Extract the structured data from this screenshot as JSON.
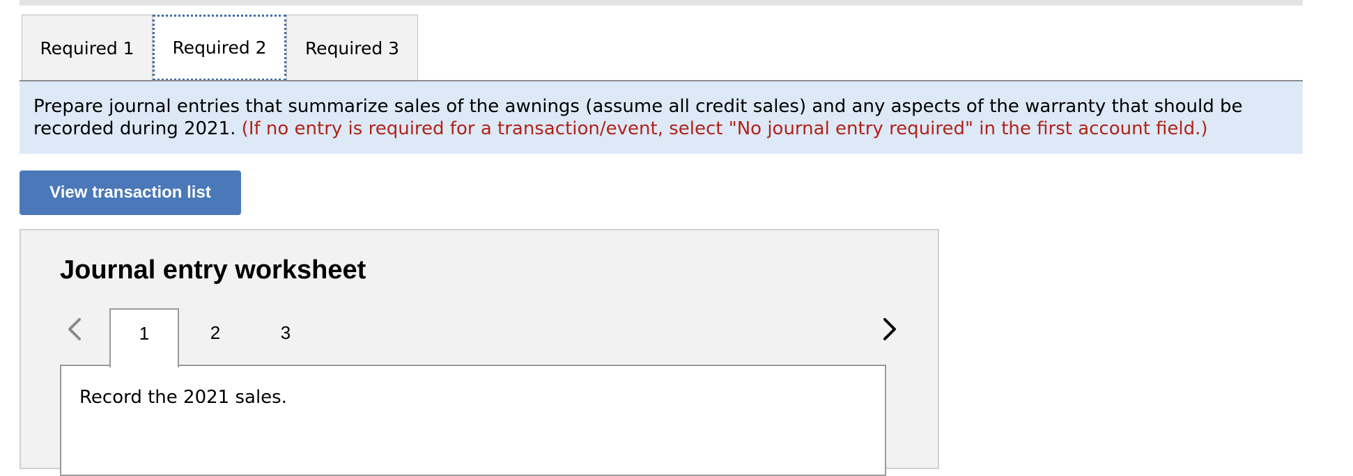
{
  "tabs": [
    {
      "label": "Required 1",
      "active": false
    },
    {
      "label": "Required 2",
      "active": true
    },
    {
      "label": "Required 3",
      "active": false
    }
  ],
  "instructions": {
    "text": "Prepare journal entries that summarize sales of the awnings (assume all credit sales) and any aspects of the warranty that should be recorded during 2021. ",
    "note": "(If no entry is required for a transaction/event, select \"No journal entry required\" in the first account field.)"
  },
  "view_transaction_button": "View transaction list",
  "worksheet": {
    "title": "Journal entry worksheet",
    "tabs": [
      "1",
      "2",
      "3"
    ],
    "active_tab": "1",
    "prompt": "Record the 2021 sales."
  },
  "colors": {
    "instruction_bg": "#dde9f6",
    "note_text": "#b0231a",
    "button_bg": "#4a78b8",
    "worksheet_bg": "#f2f2f2"
  },
  "icons": {
    "prev": "chevron-left-icon",
    "next": "chevron-right-icon"
  }
}
